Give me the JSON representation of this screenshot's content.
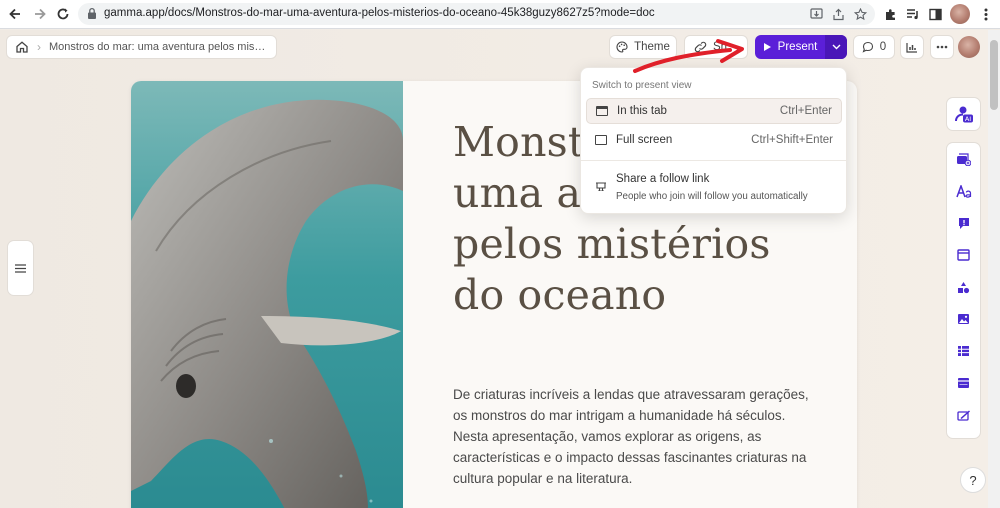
{
  "browser": {
    "url": "gamma.app/docs/Monstros-do-mar-uma-aventura-pelos-misterios-do-oceano-45k38guzy8627z5?mode=doc",
    "back_icon": "back-arrow-icon",
    "forward_icon": "forward-arrow-icon",
    "reload_icon": "reload-icon"
  },
  "header": {
    "breadcrumb_title": "Monstros do mar: uma aventura pelos mis…",
    "theme_label": "Theme",
    "share_label": "Sh",
    "present_label": "Present",
    "comments_count": "0"
  },
  "menu": {
    "heading": "Switch to present view",
    "items": [
      {
        "label": "In this tab",
        "shortcut": "Ctrl+Enter",
        "icon": "window-icon",
        "active": true
      },
      {
        "label": "Full screen",
        "shortcut": "Ctrl+Shift+Enter",
        "icon": "monitor-icon",
        "active": false
      }
    ],
    "follow": {
      "label": "Share a follow link",
      "sub": "People who join will follow you automatically",
      "icon": "present-screen-icon"
    }
  },
  "card": {
    "title": "Monstros do mar: uma aventura pelos mistérios do oceano",
    "body": "De criaturas incríveis a lendas que atravessaram gerações, os monstros do mar intrigam a humanidade há séculos. Nesta apresentação, vamos explorar as origens, as características e o impacto dessas fascinantes criaturas na cultura popular e na literatura.",
    "image_subject": "frilled shark underwater"
  },
  "sidebar": {
    "ai_badge": "AI",
    "tools": [
      "add-card-icon",
      "text-style-icon",
      "callout-icon",
      "layout-icon",
      "shapes-icon",
      "image-icon",
      "gallery-icon",
      "embed-icon",
      "form-icon"
    ]
  },
  "help_label": "?",
  "colors": {
    "present": "#5b1fd8",
    "annotation_arrow": "#e0202a",
    "sidebar_icons": "#4a2bd0"
  }
}
